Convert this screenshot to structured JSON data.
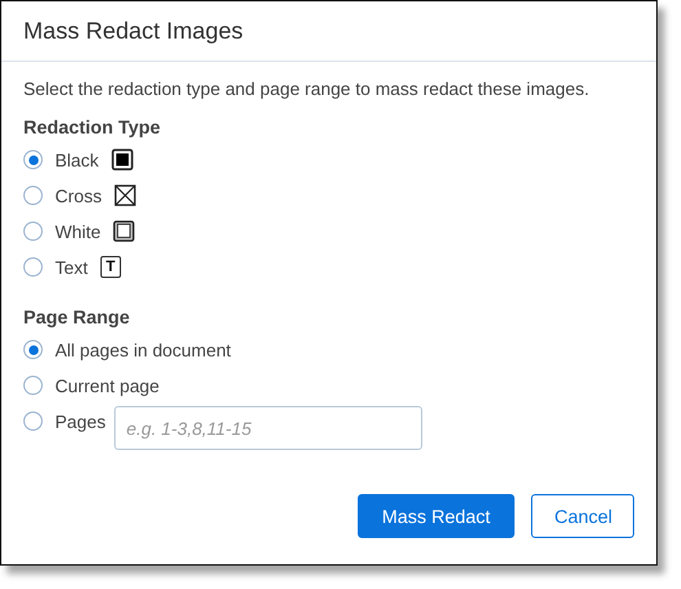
{
  "dialog": {
    "title": "Mass Redact Images",
    "description": "Select the redaction type and page range to mass redact these images.",
    "redaction_type": {
      "label": "Redaction Type",
      "options": [
        {
          "label": "Black",
          "selected": true,
          "kind": "black"
        },
        {
          "label": "Cross",
          "selected": false,
          "kind": "cross"
        },
        {
          "label": "White",
          "selected": false,
          "kind": "white"
        },
        {
          "label": "Text",
          "selected": false,
          "kind": "text",
          "icon_label": "T"
        }
      ]
    },
    "page_range": {
      "label": "Page Range",
      "options": [
        {
          "label": "All pages in document",
          "selected": true
        },
        {
          "label": "Current page",
          "selected": false
        },
        {
          "label": "Pages",
          "selected": false,
          "kind": "field",
          "placeholder": "e.g. 1-3,8,11-15"
        }
      ]
    },
    "buttons": [
      {
        "label": "Mass Redact",
        "kind": "primary"
      },
      {
        "label": "Cancel",
        "kind": "secondary"
      }
    ]
  }
}
